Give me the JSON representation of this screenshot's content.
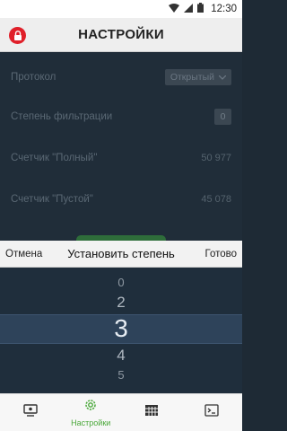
{
  "status_bar": {
    "time": "12:30"
  },
  "app_bar": {
    "title": "НАСТРОЙКИ"
  },
  "settings": {
    "protocol": {
      "label": "Протокол",
      "value": "Открытый"
    },
    "filter_level": {
      "label": "Степень фильтрации",
      "value": "0"
    },
    "counter_full": {
      "label": "Счетчик \"Полный\"",
      "value": "50 977"
    },
    "counter_empty": {
      "label": "Счетчик \"Пустой\"",
      "value": "45 078"
    }
  },
  "picker": {
    "cancel_label": "Отмена",
    "title": "Установить степень",
    "done_label": "Готово",
    "items": [
      "0",
      "2",
      "3",
      "4",
      "5"
    ],
    "selected": "3"
  },
  "bottom_nav": {
    "items": [
      {
        "icon": "monitor-icon",
        "label": ""
      },
      {
        "icon": "gear-icon",
        "label": "Настройки",
        "active": true
      },
      {
        "icon": "grid-icon",
        "label": ""
      },
      {
        "icon": "terminal-icon",
        "label": ""
      }
    ]
  },
  "colors": {
    "accent": "#4aa83a",
    "lock": "#e0202a",
    "selection": "#2e435a"
  }
}
